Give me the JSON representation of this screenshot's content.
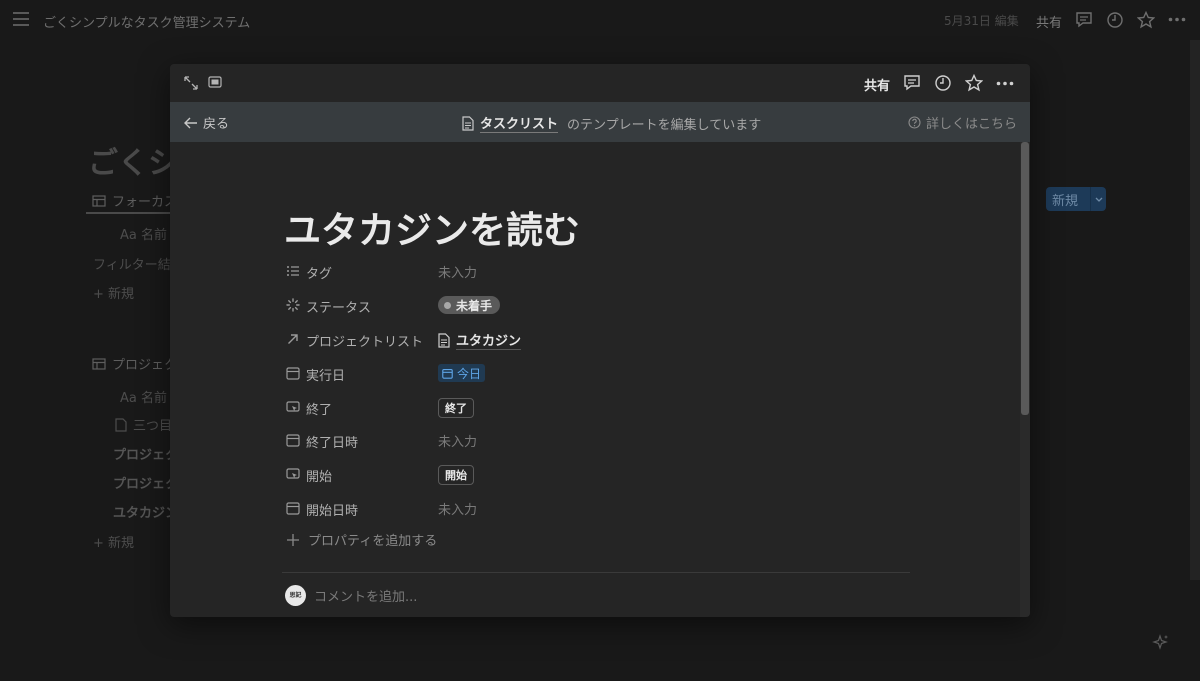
{
  "background": {
    "breadcrumb": "ごくシンプルなタスク管理システム",
    "edited": "5月31日 編集",
    "share": "共有",
    "page_title_partial": "ごくシ",
    "tab_focus": "フォーカス",
    "col_name": "Aa 名前",
    "filter_text": "フィルター結",
    "new_row": "+ 新規",
    "tab_project": "プロジェク",
    "col_name2": "Aa 名前",
    "row_1": "三つ目",
    "row_2": "プロジェク",
    "row_3": "プロジェク",
    "row_4": "ユタカジン",
    "new_row2": "+ 新規",
    "new_button": "新規"
  },
  "modal": {
    "share": "共有",
    "template_bar": {
      "back": "戻る",
      "db_name": "タスクリスト",
      "editing_text": "のテンプレートを編集しています",
      "help": "詳しくはこちら"
    },
    "title": "ユタカジンを読む",
    "properties": [
      {
        "name": "タグ",
        "value": "未入力"
      },
      {
        "name": "ステータス",
        "value": "未着手"
      },
      {
        "name": "プロジェクトリスト",
        "value": "ユタカジン"
      },
      {
        "name": "実行日",
        "value": "今日"
      },
      {
        "name": "終了",
        "value": "終了"
      },
      {
        "name": "終了日時",
        "value": "未入力"
      },
      {
        "name": "開始",
        "value": "開始"
      },
      {
        "name": "開始日時",
        "value": "未入力"
      }
    ],
    "add_property": "プロパティを追加する",
    "avatar_text": "思記",
    "comment_placeholder": "コメントを追加..."
  },
  "colors": {
    "background": "#191919",
    "modal": "#252525",
    "template_bar": "#373c3f",
    "date_chip_text": "#5fa6e8",
    "new_button": "#1d3a58"
  },
  "icons": [
    "menu-icon",
    "comment-icon",
    "clock-icon",
    "star-icon",
    "more-icon",
    "expand-icon",
    "peek-mode-icon",
    "arrow-left-icon",
    "page-icon",
    "help-icon",
    "list-icon",
    "status-icon",
    "relation-arrow-icon",
    "calendar-icon",
    "button-icon",
    "plus-icon",
    "sparkle-icon"
  ]
}
